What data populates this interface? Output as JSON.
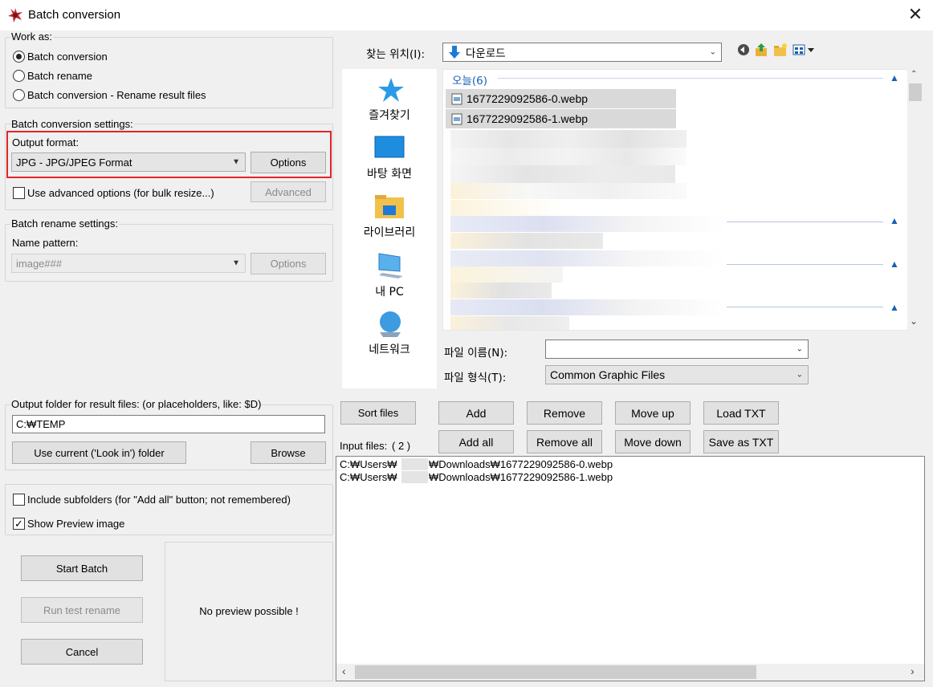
{
  "window": {
    "title": "Batch conversion",
    "close_glyph": "✕"
  },
  "work_as": {
    "label": "Work as:",
    "options": [
      "Batch conversion",
      "Batch rename",
      "Batch conversion - Rename result files"
    ],
    "selected": "Batch conversion"
  },
  "conversion_settings": {
    "label": "Batch conversion settings:",
    "output_format_label": "Output format:",
    "output_format_value": "JPG - JPG/JPEG Format",
    "options_button": "Options",
    "advanced_checkbox": "Use advanced options (for bulk resize...)",
    "advanced_button": "Advanced"
  },
  "rename_settings": {
    "label": "Batch rename settings:",
    "pattern_label": "Name pattern:",
    "pattern_value": "image###",
    "options_button": "Options"
  },
  "output_folder": {
    "label": "Output folder for result files: (or placeholders, like: $D)",
    "value": "C:₩TEMP",
    "use_current_button": "Use current ('Look in') folder",
    "browse_button": "Browse"
  },
  "checkboxes": {
    "include_subfolders": "Include subfolders (for \"Add all\" button; not remembered)",
    "show_preview": "Show Preview image",
    "show_preview_checked": true
  },
  "actions": {
    "start": "Start Batch",
    "run_test": "Run test rename",
    "cancel": "Cancel"
  },
  "preview_text": "No preview possible !",
  "look_in": {
    "label": "찾는 위치(I):",
    "value": "다운로드"
  },
  "places": [
    "즐겨찾기",
    "바탕 화면",
    "라이브러리",
    "내 PC",
    "네트워크"
  ],
  "file_list": {
    "group_header": "오늘(6)",
    "files": [
      "1677229092586-0.webp",
      "1677229092586-1.webp"
    ]
  },
  "file_name": {
    "label": "파일 이름(N):",
    "value": ""
  },
  "file_type": {
    "label": "파일 형식(T):",
    "value": "Common Graphic Files"
  },
  "buttons": {
    "sort_files": "Sort files",
    "add": "Add",
    "remove": "Remove",
    "move_up": "Move up",
    "load_txt": "Load TXT",
    "add_all": "Add all",
    "remove_all": "Remove all",
    "move_down": "Move down",
    "save_txt": "Save as TXT"
  },
  "input_files": {
    "label": "Input files:",
    "count": "( 2 )",
    "paths": [
      {
        "prefix": "C:₩Users₩",
        "suffix": "₩Downloads₩1677229092586-0.webp"
      },
      {
        "prefix": "C:₩Users₩",
        "suffix": "₩Downloads₩1677229092586-1.webp"
      }
    ]
  },
  "colors": {
    "accent": "#1a5fb4",
    "highlight_border": "#e0262a",
    "selected_row": "#d9d9d9"
  }
}
